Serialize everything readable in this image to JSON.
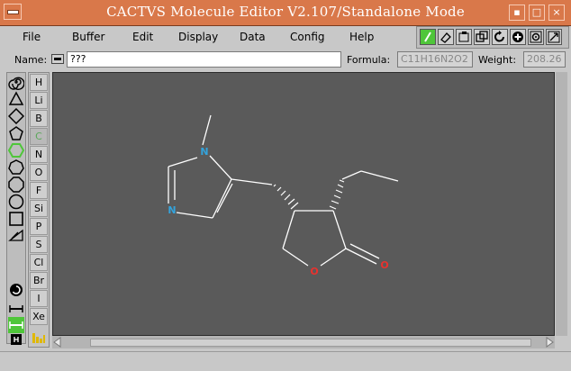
{
  "window": {
    "title": "CACTVS Molecule Editor V2.107/Standalone Mode",
    "sys_icon": "window-menu-icon",
    "buttons": [
      "minimize-icon",
      "maximize-icon",
      "close-icon"
    ]
  },
  "menu": {
    "items": [
      "File",
      "Buffer",
      "Edit",
      "Display",
      "Data",
      "Config",
      "Help"
    ]
  },
  "toolbar": {
    "icons": [
      "pencil-icon",
      "eraser-icon",
      "select-box-icon",
      "copy-icon",
      "rotate-icon",
      "zoom-icon",
      "atom-map-icon",
      "resize-icon"
    ]
  },
  "info": {
    "name_label": "Name:",
    "name_value": "???",
    "formula_label": "Formula:",
    "formula_value": "C11H16N2O2",
    "weight_label": "Weight:",
    "weight_value": "208.26"
  },
  "elements": [
    "H",
    "Li",
    "B",
    "C",
    "N",
    "O",
    "F",
    "Si",
    "P",
    "S",
    "Cl",
    "Br",
    "I",
    "Xe"
  ],
  "selected_element": "C",
  "ring_tools": [
    "spiral-icon",
    "triangle-icon",
    "square-icon",
    "pentagon-icon",
    "hexagon-icon",
    "heptagon-icon",
    "octagon-icon",
    "nonagon-icon",
    "rectangle-icon",
    "template-icon",
    "rotate-bond-icon",
    "single-bond-icon",
    "chain-icon",
    "bracket-icon"
  ],
  "molecule": {
    "atom_labels": {
      "n1": "N",
      "n2": "N",
      "o1": "O",
      "o2": "O"
    },
    "colors": {
      "nitrogen": "#33a3dc",
      "oxygen": "#e8322e",
      "bond": "#ffffff",
      "background": "#5a5a5a"
    }
  },
  "colors": {
    "titlebar": "#d9784a",
    "selected_ring": "#4fc63a"
  }
}
